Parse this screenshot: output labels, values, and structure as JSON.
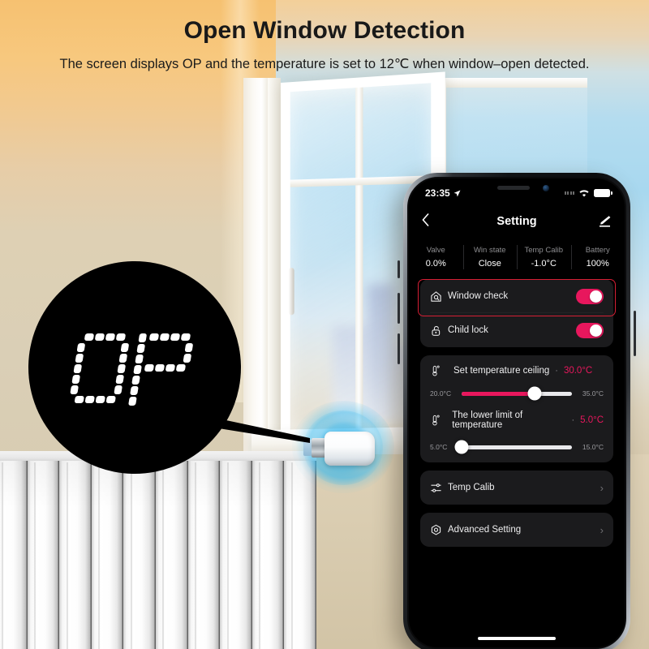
{
  "banner": {
    "title": "Open Window Detection",
    "subtitle": "The screen displays OP and the temperature is set to 12℃ when window–open detected."
  },
  "device_display": {
    "code": "OP",
    "icon": "segment-lcd-display"
  },
  "phone": {
    "status_bar": {
      "time": "23:35",
      "location_icon": "location-arrow-icon",
      "wifi_icon": "wifi-icon",
      "battery_icon": "battery-full-icon"
    },
    "nav": {
      "back_icon": "chevron-left-icon",
      "title": "Setting",
      "edit_icon": "pencil-edit-icon"
    },
    "summary": [
      {
        "label": "Valve",
        "value": "0.0%"
      },
      {
        "label": "Win state",
        "value": "Close"
      },
      {
        "label": "Temp Calib",
        "value": "-1.0°C"
      },
      {
        "label": "Battery",
        "value": "100%"
      }
    ],
    "toggles": [
      {
        "label": "Window check",
        "icon": "home-search-icon",
        "state": "on",
        "highlighted": true
      },
      {
        "label": "Child lock",
        "icon": "open-padlock-icon",
        "state": "on",
        "highlighted": false
      }
    ],
    "sliders": [
      {
        "icon": "thermometer-icon",
        "label": "Set temperature ceiling",
        "separator": "·",
        "value": "30.0°C",
        "min_label": "20.0°C",
        "max_label": "35.0°C",
        "percent": 66
      },
      {
        "icon": "thermometer-icon",
        "label": "The lower limit of temperature",
        "separator": "·",
        "value": "5.0°C",
        "min_label": "5.0°C",
        "max_label": "15.0°C",
        "percent": 0
      }
    ],
    "menu_items": [
      {
        "label": "Temp Calib",
        "icon": "sliders-icon",
        "chevron": "›"
      },
      {
        "label": "Advanced Setting",
        "icon": "gear-hex-icon",
        "chevron": "›"
      }
    ]
  },
  "colors": {
    "accent_pink": "#e8175d",
    "highlight_red": "#d61f35",
    "card_bg": "#1b1b1d",
    "screen_bg": "#000000",
    "glow_blue": "#28b2ec"
  }
}
